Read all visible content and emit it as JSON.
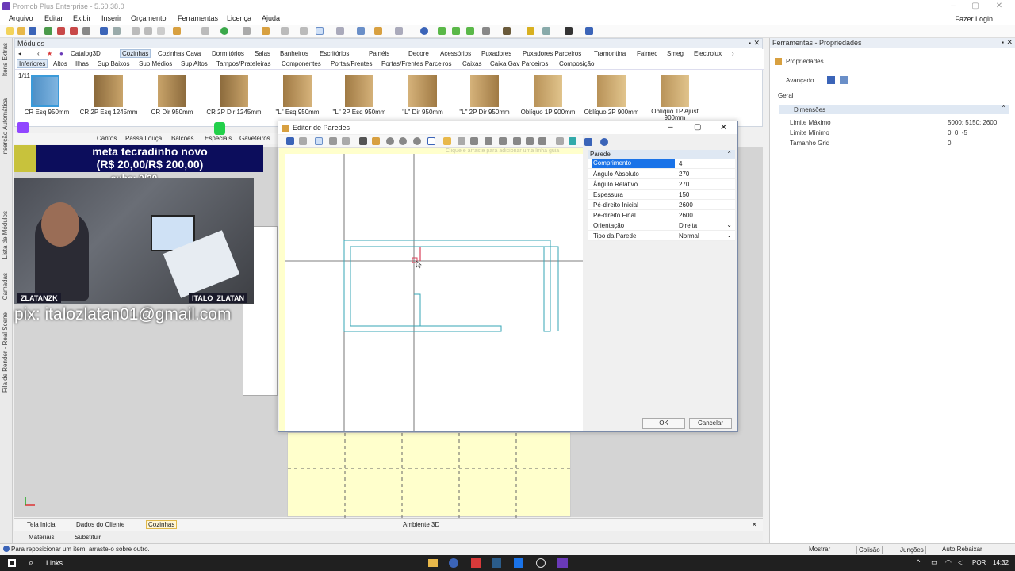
{
  "window": {
    "title": "Promob Plus Enterprise - 5.60.38.0",
    "login": "Fazer Login"
  },
  "menu": [
    "Arquivo",
    "Editar",
    "Exibir",
    "Inserir",
    "Orçamento",
    "Ferramentas",
    "Licença",
    "Ajuda"
  ],
  "modules": {
    "header": "Módulos",
    "page_indicator": "1/11",
    "tabs_row1": [
      "Catalog3D",
      "Cozinhas",
      "Cozinhas Cava",
      "Dormitórios",
      "Salas",
      "Banheiros",
      "Escritórios",
      "Painéis",
      "Decore",
      "Acessórios",
      "Puxadores",
      "Puxadores Parceiros",
      "Tramontina",
      "Falmec",
      "Smeg",
      "Electrolux"
    ],
    "tabs_row2": [
      "Inferiores",
      "Altos",
      "Ilhas",
      "Sup Baixos",
      "Sup Médios",
      "Sup Altos",
      "Tampos/Prateleiras",
      "Componentes",
      "Portas/Frentes",
      "Portas/Frentes Parceiros",
      "Caixas",
      "Caixa Gav Parceiros",
      "Composição"
    ],
    "items": [
      "CR Esq 950mm",
      "CR 2P Esq 1245mm",
      "CR Dir 950mm",
      "CR 2P Dir 1245mm",
      "\"L\" Esq 950mm",
      "\"L\" 2P Esq 950mm",
      "\"L\" Dir 950mm",
      "\"L\" 2P Dir 950mm",
      "Oblíquo 1P 900mm",
      "Oblíquo 2P 900mm",
      "Oblíquo 1P Ajust 900mm"
    ],
    "tabs_row3": [
      "Cantos",
      "Passa Louça",
      "Balcões",
      "Especiais",
      "Gaveteiros"
    ]
  },
  "left_strip": [
    "Itens Extras",
    "Inserção Automática",
    "Lista de Módulos",
    "Camadas",
    "Fila de Render - Real Scene"
  ],
  "dialog": {
    "title": "Editor de Paredes",
    "hint": "Clique e arraste para adicionar uma linha guia",
    "section": "Parede",
    "rows": [
      {
        "k": "Comprimento",
        "v": "4"
      },
      {
        "k": "Ângulo Absoluto",
        "v": "270"
      },
      {
        "k": "Ângulo Relativo",
        "v": "270"
      },
      {
        "k": "Espessura",
        "v": "150"
      },
      {
        "k": "Pé-direito Inicial",
        "v": "2600"
      },
      {
        "k": "Pé-direito Final",
        "v": "2600"
      },
      {
        "k": "Orientação",
        "v": "Direita"
      },
      {
        "k": "Tipo da Parede",
        "v": "Normal"
      }
    ],
    "ok": "OK",
    "cancel": "Cancelar"
  },
  "right_panel": {
    "header": "Ferramentas - Propriedades",
    "title": "Propriedades",
    "advanced": "Avançado",
    "tab": "Geral",
    "section": "Dimensões",
    "rows": [
      {
        "k": "Limite Máximo",
        "v": "5000; 5150; 2600"
      },
      {
        "k": "Limite Mínimo",
        "v": "0; 0; -5"
      },
      {
        "k": "Tamanho Grid",
        "v": "0"
      }
    ]
  },
  "stream": {
    "meta": "meta tecradinho novo",
    "meta_value": "(R$ 20,00/R$ 200,00)",
    "subs": "subs: 0/20",
    "name_left": "ZLATANZK",
    "name_right": "ITALO_ZLATAN",
    "pix": "pix: italozlatan01@gmail.com"
  },
  "bottom_tabs": [
    "Tela Inicial",
    "Dados do Cliente",
    "Cozinhas"
  ],
  "env3d": "Ambiente 3D",
  "materials": [
    "Materiais",
    "Substituir"
  ],
  "status": {
    "message": "Para reposicionar um item, arraste-o sobre outro.",
    "mostrar": "Mostrar",
    "colisao": "Colisão",
    "juncoes": "Junções",
    "auto": "Auto Rebaixar"
  },
  "taskbar": {
    "search": "Links",
    "lang": "POR",
    "time": "14:32"
  }
}
